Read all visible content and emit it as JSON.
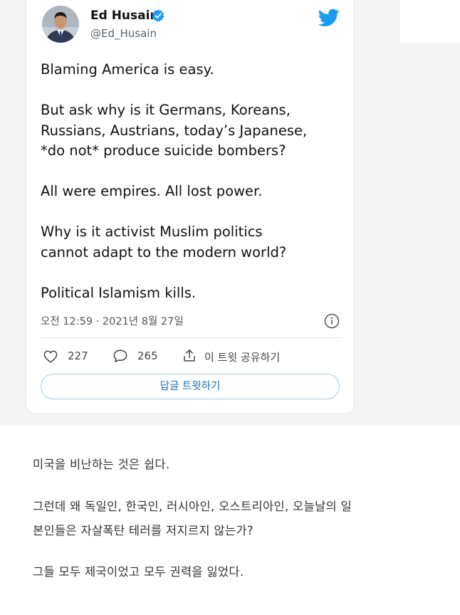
{
  "colors": {
    "accent": "#1d9bf0",
    "verified": "#1d9bf0",
    "reply_border": "#9bc8ee",
    "page_bg_top": "#f4f4f4"
  },
  "tweet": {
    "author_name": "Ed Husain",
    "handle": "@Ed_Husain",
    "verified_icon": "verified-badge-icon",
    "platform_icon": "twitter-bird-icon",
    "body_lines": [
      "Blaming America is easy.",
      "But ask why is it Germans, Koreans,",
      "Russians, Austrians, today’s Japanese,",
      "*do not* produce suicide bombers?",
      "All were empires. All lost power.",
      "Why is it activist Muslim politics",
      "cannot adapt to the modern world?",
      "Political Islamism kills."
    ],
    "timestamp": "오전 12:59 · 2021년 8월 27일",
    "likes": "227",
    "replies": "265",
    "share_label": "이 트윗 공유하기",
    "reply_button_label": "답글 트윗하기"
  },
  "translation": {
    "lines": [
      "미국을 비난하는 것은 쉽다.",
      "그런데 왜 독일인, 한국인, 러시아인, 오스트리아인, 오늘날의 일",
      "본인들은 자살폭탄 테러를 저지르지 않는가?",
      "그들 모두 제국이었고 모두 권력을 잃었다."
    ]
  }
}
